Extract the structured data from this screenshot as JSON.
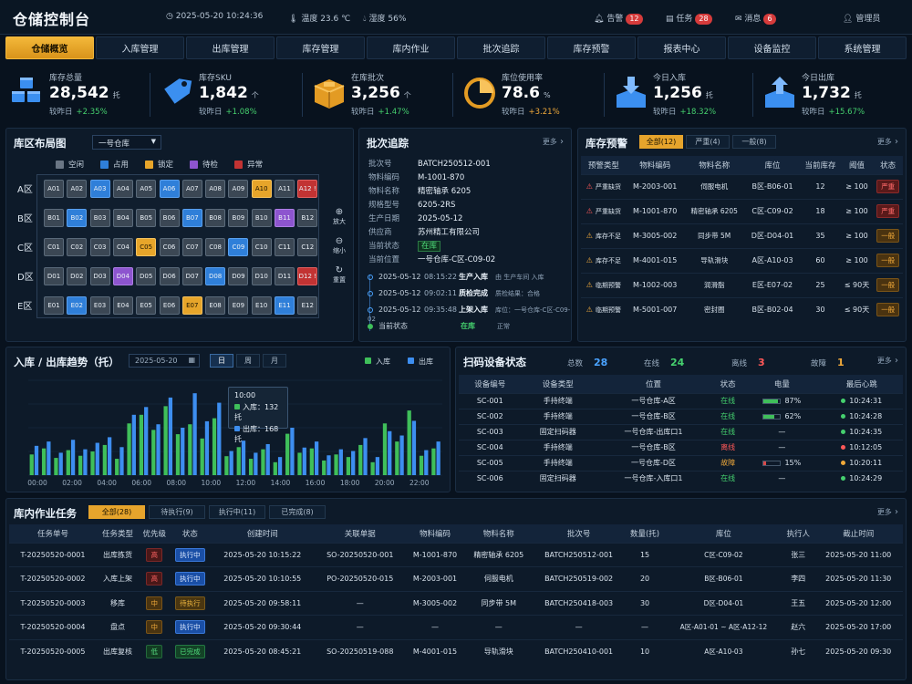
{
  "header": {
    "title": "仓储控制台",
    "datetime": "2025-05-20 10:24:36",
    "temp_label": "温度",
    "temp": "23.6 ℃",
    "hum_label": "湿度",
    "hum": "56%",
    "alarm_label": "告警",
    "alarm_count": "12",
    "task_label": "任务",
    "task_count": "28",
    "msg_label": "消息",
    "msg_count": "6",
    "user": "管理员"
  },
  "nav": [
    "仓储概览",
    "入库管理",
    "出库管理",
    "库存管理",
    "库内作业",
    "批次追踪",
    "库存预警",
    "报表中心",
    "设备监控",
    "系统管理"
  ],
  "kpis": [
    {
      "label": "库存总量",
      "value": "28,542",
      "unit": "托",
      "cmp": "较昨日",
      "delta": "+2.35%"
    },
    {
      "label": "库存SKU",
      "value": "1,842",
      "unit": "个",
      "cmp": "较昨日",
      "delta": "+1.08%"
    },
    {
      "label": "在库批次",
      "value": "3,256",
      "unit": "个",
      "cmp": "较昨日",
      "delta": "+1.47%"
    },
    {
      "label": "库位使用率",
      "value": "78.6",
      "unit": "%",
      "cmp": "较昨日",
      "delta": "+3.21%"
    },
    {
      "label": "今日入库",
      "value": "1,256",
      "unit": "托",
      "cmp": "较昨日",
      "delta": "+18.32%"
    },
    {
      "label": "今日出库",
      "value": "1,732",
      "unit": "托",
      "cmp": "较昨日",
      "delta": "+15.67%"
    }
  ],
  "zone": {
    "title": "库区布局图",
    "select": "一号仓库",
    "legend": [
      "空闲",
      "占用",
      "锁定",
      "待检",
      "异常"
    ],
    "rows": [
      {
        "label": "A区",
        "cells": [
          [
            "A01",
            "e"
          ],
          [
            "A02",
            "e"
          ],
          [
            "A03",
            "u"
          ],
          [
            "A04",
            "e"
          ],
          [
            "A05",
            "e"
          ],
          [
            "A06",
            "u"
          ],
          [
            "A07",
            "e"
          ],
          [
            "A08",
            "e"
          ],
          [
            "A09",
            "e"
          ],
          [
            "A10",
            "l"
          ],
          [
            "A11",
            "e"
          ],
          [
            "A12 !",
            "x"
          ]
        ]
      },
      {
        "label": "B区",
        "cells": [
          [
            "B01",
            "e"
          ],
          [
            "B02",
            "u"
          ],
          [
            "B03",
            "e"
          ],
          [
            "B04",
            "e"
          ],
          [
            "B05",
            "e"
          ],
          [
            "B06",
            "e"
          ],
          [
            "B07",
            "u"
          ],
          [
            "B08",
            "e"
          ],
          [
            "B09",
            "e"
          ],
          [
            "B10",
            "e"
          ],
          [
            "B11",
            "c"
          ],
          [
            "B12",
            "e"
          ]
        ]
      },
      {
        "label": "C区",
        "cells": [
          [
            "C01",
            "e"
          ],
          [
            "C02",
            "e"
          ],
          [
            "C03",
            "e"
          ],
          [
            "C04",
            "e"
          ],
          [
            "C05",
            "l"
          ],
          [
            "C06",
            "e"
          ],
          [
            "C07",
            "e"
          ],
          [
            "C08",
            "e"
          ],
          [
            "C09",
            "u"
          ],
          [
            "C10",
            "e"
          ],
          [
            "C11",
            "e"
          ],
          [
            "C12",
            "e"
          ]
        ]
      },
      {
        "label": "D区",
        "cells": [
          [
            "D01",
            "e"
          ],
          [
            "D02",
            "e"
          ],
          [
            "D03",
            "e"
          ],
          [
            "D04",
            "c"
          ],
          [
            "D05",
            "e"
          ],
          [
            "D06",
            "e"
          ],
          [
            "D07",
            "e"
          ],
          [
            "D08",
            "u"
          ],
          [
            "D09",
            "e"
          ],
          [
            "D10",
            "e"
          ],
          [
            "D11",
            "e"
          ],
          [
            "D12 !",
            "x"
          ]
        ]
      },
      {
        "label": "E区",
        "cells": [
          [
            "E01",
            "e"
          ],
          [
            "E02",
            "u"
          ],
          [
            "E03",
            "e"
          ],
          [
            "E04",
            "e"
          ],
          [
            "E05",
            "e"
          ],
          [
            "E06",
            "e"
          ],
          [
            "E07",
            "l"
          ],
          [
            "E08",
            "e"
          ],
          [
            "E09",
            "e"
          ],
          [
            "E10",
            "e"
          ],
          [
            "E11",
            "u"
          ],
          [
            "E12",
            "e"
          ]
        ]
      }
    ],
    "zoom_in": "放大",
    "zoom_out": "缩小",
    "reset": "重置"
  },
  "batch": {
    "title": "批次追踪",
    "more": "更多",
    "fields": [
      [
        "批次号",
        "BATCH250512-001"
      ],
      [
        "物料编码",
        "M-1001-870"
      ],
      [
        "物料名称",
        "精密轴承 6205"
      ],
      [
        "规格型号",
        "6205-2RS"
      ],
      [
        "生产日期",
        "2025-05-12"
      ],
      [
        "供应商",
        "苏州精工有限公司"
      ],
      [
        "当前状态",
        "在库"
      ],
      [
        "当前位置",
        "一号仓库-C区-C09-02"
      ]
    ],
    "timeline": [
      [
        "2025-05-12",
        "08:15:22",
        "生产入库",
        "由 生产车间 入库"
      ],
      [
        "2025-05-12",
        "09:02:11",
        "质检完成",
        "质检结果：合格"
      ],
      [
        "2025-05-12",
        "09:35:48",
        "上架入库",
        "库位：一号仓库-C区-C09-02"
      ],
      [
        "当前状态",
        "",
        "在库",
        "正常"
      ]
    ]
  },
  "alert": {
    "title": "库存预警",
    "more": "更多",
    "tabs": [
      "全部(12)",
      "严重(4)",
      "一般(8)"
    ],
    "headers": [
      "预警类型",
      "物料编码",
      "物料名称",
      "库位",
      "当前库存",
      "阈值",
      "状态"
    ],
    "rows": [
      [
        "严重缺货",
        "M-2003-001",
        "伺服电机",
        "B区-B06-01",
        "12",
        "≥ 100",
        "严重"
      ],
      [
        "严重缺货",
        "M-1001-870",
        "精密轴承 6205",
        "C区-C09-02",
        "18",
        "≥ 100",
        "严重"
      ],
      [
        "库存不足",
        "M-3005-002",
        "同步带 5M",
        "D区-D04-01",
        "35",
        "≥ 100",
        "一般"
      ],
      [
        "库存不足",
        "M-4001-015",
        "导轨滑块",
        "A区-A10-03",
        "60",
        "≥ 100",
        "一般"
      ],
      [
        "临期预警",
        "M-1002-003",
        "润滑脂",
        "E区-E07-02",
        "25",
        "≤ 90天",
        "一般"
      ],
      [
        "临期预警",
        "M-5001-007",
        "密封圈",
        "B区-B02-04",
        "30",
        "≤ 90天",
        "一般"
      ]
    ]
  },
  "trend": {
    "title": "入库 / 出库趋势（托）",
    "date": "2025-05-20",
    "modes": [
      "日",
      "周",
      "月"
    ],
    "tooltip_time": "10:00",
    "tooltip_in_label": "入库：",
    "tooltip_in": "132 托",
    "tooltip_out_label": "出库：",
    "tooltip_out": "168 托"
  },
  "chart_data": {
    "type": "bar",
    "series": [
      {
        "name": "入库",
        "color": "#3fbf5a",
        "values": [
          48,
          62,
          40,
          58,
          45,
          55,
          70,
          38,
          120,
          140,
          105,
          160,
          95,
          118,
          85,
          132,
          44,
          65,
          38,
          60,
          30,
          96,
          52,
          62,
          34,
          48,
          42,
          70,
          30,
          120,
          78,
          150,
          45,
          62
        ]
      },
      {
        "name": "出库",
        "color": "#3d8ef0",
        "values": [
          68,
          78,
          52,
          82,
          60,
          75,
          88,
          65,
          140,
          158,
          118,
          180,
          110,
          190,
          125,
          168,
          56,
          80,
          52,
          72,
          42,
          110,
          64,
          78,
          46,
          60,
          56,
          86,
          42,
          102,
          92,
          126,
          58,
          78
        ]
      }
    ],
    "x_ticks": [
      "00:00",
      "02:00",
      "04:00",
      "06:00",
      "08:00",
      "10:00",
      "12:00",
      "14:00",
      "16:00",
      "18:00",
      "20:00",
      "22:00"
    ],
    "ylim": [
      0,
      220
    ]
  },
  "scanner": {
    "title": "扫码设备状态",
    "total_label": "总数",
    "total": "28",
    "online_label": "在线",
    "online": "24",
    "offline_label": "离线",
    "offline": "3",
    "fault_label": "故障",
    "fault": "1",
    "more": "更多",
    "headers": [
      "设备编号",
      "设备类型",
      "位置",
      "状态",
      "电量",
      "最后心跳"
    ],
    "rows": [
      [
        "SC-001",
        "手持终端",
        "一号仓库-A区",
        "在线",
        "87%",
        "10:24:31"
      ],
      [
        "SC-002",
        "手持终端",
        "一号仓库-B区",
        "在线",
        "62%",
        "10:24:28"
      ],
      [
        "SC-003",
        "固定扫码器",
        "一号仓库-出库口1",
        "在线",
        "—",
        "10:24:35"
      ],
      [
        "SC-004",
        "手持终端",
        "一号仓库-B区",
        "离线",
        "—",
        "10:12:05"
      ],
      [
        "SC-005",
        "手持终端",
        "一号仓库-D区",
        "故障",
        "15%",
        "10:20:11"
      ],
      [
        "SC-006",
        "固定扫码器",
        "一号仓库-入库口1",
        "在线",
        "—",
        "10:24:29"
      ]
    ]
  },
  "tasks": {
    "title": "库内作业任务",
    "more": "更多",
    "tabs": [
      "全部(28)",
      "待执行(9)",
      "执行中(11)",
      "已完成(8)"
    ],
    "headers": [
      "任务单号",
      "任务类型",
      "优先级",
      "状态",
      "创建时间",
      "关联单据",
      "物料编码",
      "物料名称",
      "批次号",
      "数量(托)",
      "库位",
      "执行人",
      "截止时间"
    ],
    "rows": [
      [
        "T-20250520-0001",
        "出库拣货",
        "高",
        "执行中",
        "2025-05-20 10:15:22",
        "SO-20250520-001",
        "M-1001-870",
        "精密轴承 6205",
        "BATCH250512-001",
        "15",
        "C区-C09-02",
        "张三",
        "2025-05-20 11:00"
      ],
      [
        "T-20250520-0002",
        "入库上架",
        "高",
        "执行中",
        "2025-05-20 10:10:55",
        "PO-20250520-015",
        "M-2003-001",
        "伺服电机",
        "BATCH250519-002",
        "20",
        "B区-B06-01",
        "李四",
        "2025-05-20 11:30"
      ],
      [
        "T-20250520-0003",
        "移库",
        "中",
        "待执行",
        "2025-05-20 09:58:11",
        "—",
        "M-3005-002",
        "同步带 5M",
        "BATCH250418-003",
        "30",
        "D区-D04-01",
        "王五",
        "2025-05-20 12:00"
      ],
      [
        "T-20250520-0004",
        "盘点",
        "中",
        "执行中",
        "2025-05-20 09:30:44",
        "—",
        "—",
        "—",
        "—",
        "—",
        "A区-A01-01 ~ A区-A12-12",
        "赵六",
        "2025-05-20 17:00"
      ],
      [
        "T-20250520-0005",
        "出库复核",
        "低",
        "已完成",
        "2025-05-20 08:45:21",
        "SO-20250519-088",
        "M-4001-015",
        "导轨滑块",
        "BATCH250410-001",
        "10",
        "A区-A10-03",
        "孙七",
        "2025-05-20 09:30"
      ]
    ]
  }
}
